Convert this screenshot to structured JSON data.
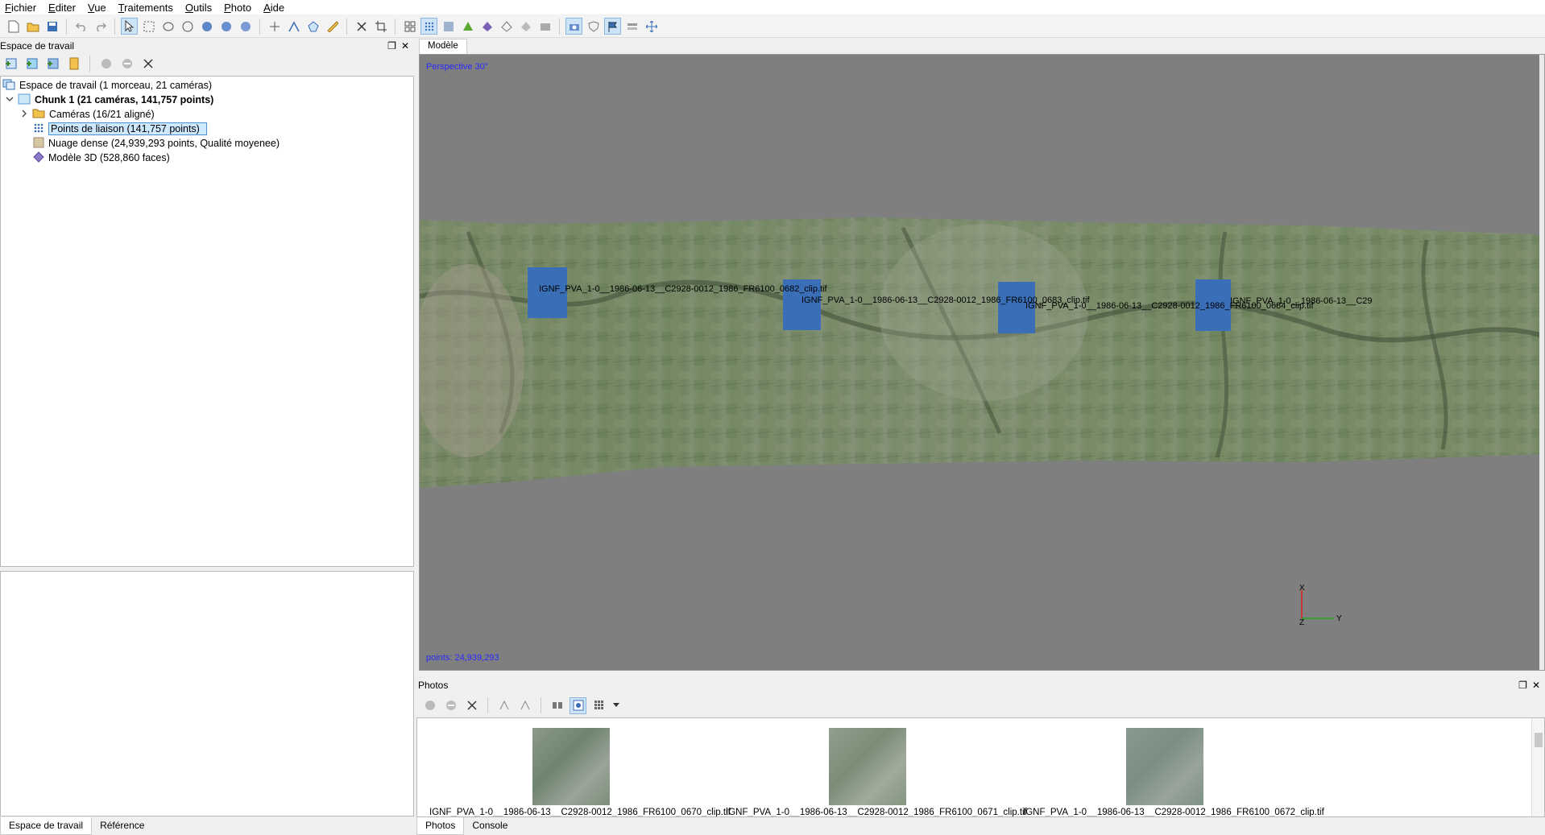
{
  "menu": [
    "Fichier",
    "Editer",
    "Vue",
    "Traitements",
    "Outils",
    "Photo",
    "Aide"
  ],
  "workspace": {
    "title": "Espace de travail",
    "root": "Espace de travail (1 morceau, 21 caméras)",
    "chunk": "Chunk 1 (21 caméras, 141,757 points)",
    "cameras": "Caméras (16/21 aligné)",
    "tie_points": "Points de liaison (141,757 points)",
    "dense_cloud": "Nuage dense (24,939,293 points, Qualité moyenee)",
    "model": "Modèle 3D (528,860 faces)"
  },
  "left_tabs": [
    "Espace de travail",
    "Référence"
  ],
  "model_tab": "Modèle",
  "viewport": {
    "perspective": "Perspective 30°",
    "points": "points: 24,939,293",
    "camera_labels": [
      "IGNF_PVA_1-0__1986-06-13__C2928-0012_1986_FR6100_0682_clip.tif",
      "IGNF_PVA_1-0__1986-06-13__C2928-0012_1986_FR6100_0683_clip.tif",
      "IGNF_PVA_1-0__1986-06-13__C2928-0012_1986_FR6100_0684_clip.tif",
      "IGNF_PVA_1-0__1986-06-13__C29"
    ],
    "axis_x": "X",
    "axis_y": "Y",
    "axis_z": "Z"
  },
  "photos": {
    "title": "Photos",
    "items": [
      "IGNF_PVA_1-0__1986-06-13__C2928-0012_1986_FR6100_0670_clip.tif",
      "IGNF_PVA_1-0__1986-06-13__C2928-0012_1986_FR6100_0671_clip.tif",
      "IGNF_PVA_1-0__1986-06-13__C2928-0012_1986_FR6100_0672_clip.tif"
    ]
  },
  "right_tabs": [
    "Photos",
    "Console"
  ],
  "colors": {
    "viewport_bg": "#7f7f7f",
    "camera_blue": "#3a6fb8",
    "overlay_text": "#2a2aff"
  }
}
